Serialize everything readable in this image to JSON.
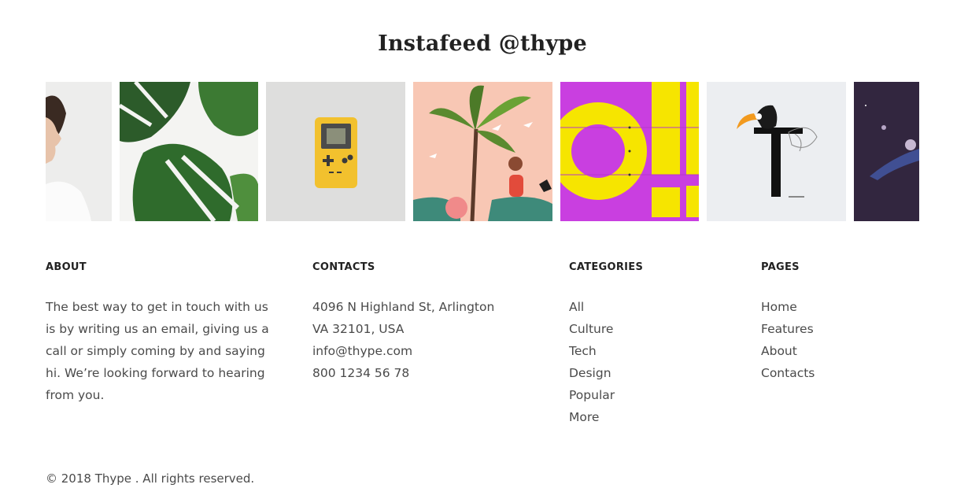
{
  "instafeed": {
    "title": "Instafeed @thype"
  },
  "footer": {
    "about": {
      "heading": "ABOUT",
      "text": "The best way to get in touch with us is by writing us an email, giving us a call or simply coming by and saying hi. We’re looking forward to hearing from you."
    },
    "contacts": {
      "heading": "CONTACTS",
      "address_line1": "4096 N Highland St, Arlington",
      "address_line2": "VA 32101, USA",
      "email": "info@thype.com",
      "phone": "800 1234 56 78"
    },
    "categories": {
      "heading": "CATEGORIES",
      "items": [
        "All",
        "Culture",
        "Tech",
        "Design",
        "Popular",
        "More"
      ]
    },
    "pages": {
      "heading": "PAGES",
      "items": [
        "Home",
        "Features",
        "About",
        "Contacts"
      ]
    },
    "copyright": "© 2018 Thype . All rights reserved."
  },
  "colors": {
    "heading": "#222222",
    "body_text": "#4a4a4a",
    "accent_magenta": "#c93fe0",
    "accent_yellow": "#f6e500"
  }
}
